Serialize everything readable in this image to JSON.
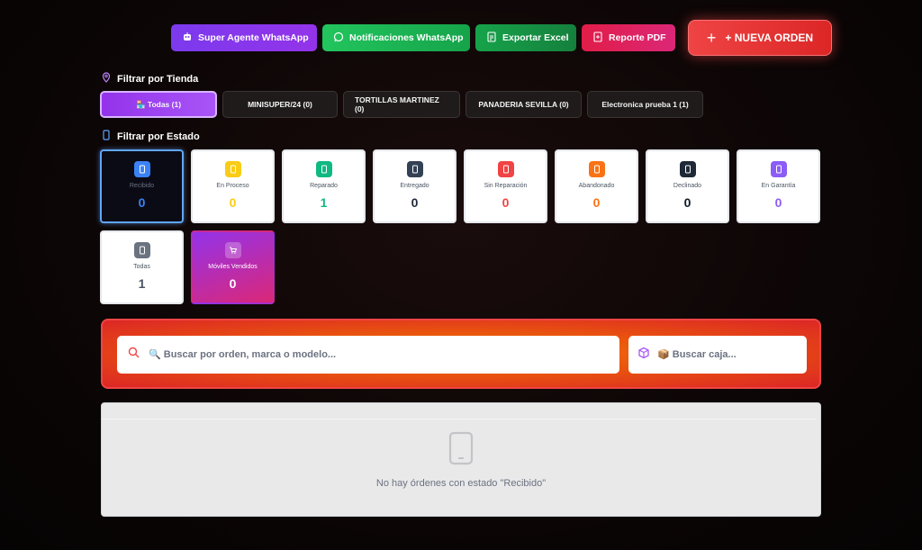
{
  "toolbar": {
    "super_agente": "Super Agente WhatsApp",
    "notificaciones": "Notificaciones WhatsApp",
    "exportar": "Exportar Excel",
    "reporte": "Reporte PDF",
    "nueva_orden": "+ NUEVA ORDEN"
  },
  "filters": {
    "store_title": "Filtrar por Tienda",
    "state_title": "Filtrar por Estado"
  },
  "stores": [
    {
      "label": "🏪 Todas (1)"
    },
    {
      "label": "MINISUPER/24 (0)"
    },
    {
      "label": "TORTILLAS MARTINEZ (0)"
    },
    {
      "label": "PANADERIA SEVILLA (0)"
    },
    {
      "label": "Electronica prueba 1 (1)"
    }
  ],
  "states": [
    {
      "label": "Recibido",
      "count": "0",
      "color": "#3b82f6"
    },
    {
      "label": "En Proceso",
      "count": "0",
      "color": "#facc15"
    },
    {
      "label": "Reparado",
      "count": "1",
      "color": "#10b981"
    },
    {
      "label": "Entregado",
      "count": "0",
      "color": "#334155"
    },
    {
      "label": "Sin Reparación",
      "count": "0",
      "color": "#ef4444"
    },
    {
      "label": "Abandonado",
      "count": "0",
      "color": "#f97316"
    },
    {
      "label": "Declinado",
      "count": "0",
      "color": "#1f2937"
    },
    {
      "label": "En Garantía",
      "count": "0",
      "color": "#8b5cf6"
    },
    {
      "label": "Todas",
      "count": "1",
      "color": "#6b7280"
    },
    {
      "label": "Móviles Vendidos",
      "count": "0",
      "color": "#ffffff"
    }
  ],
  "search": {
    "main_placeholder": "🔍 Buscar por orden, marca o modelo...",
    "box_placeholder": "📦 Buscar caja..."
  },
  "empty_state": {
    "message": "No hay órdenes con estado \"Recibido\""
  }
}
